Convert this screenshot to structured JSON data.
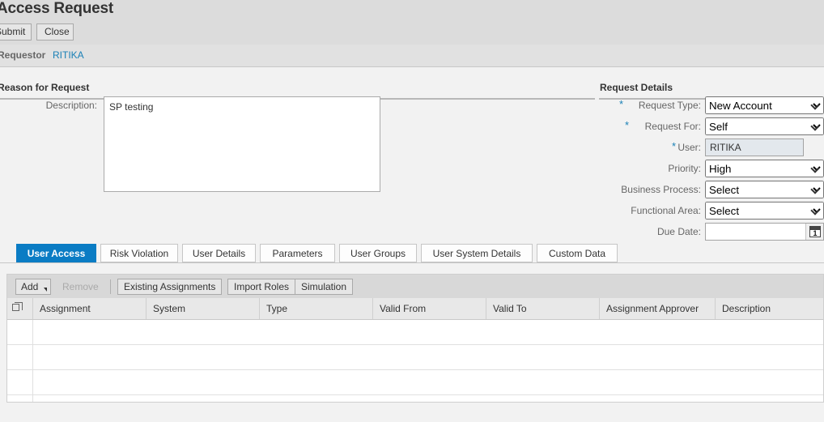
{
  "header": {
    "title": "Access Request",
    "submit_label": "Submit",
    "close_label": "Close",
    "requestor_label": "Requestor",
    "requestor_value": "RITIKA"
  },
  "reason_section": {
    "title": "Reason for Request",
    "description_label": "Description:",
    "description_value": "SP testing"
  },
  "request_details": {
    "title": "Request Details",
    "fields": [
      {
        "label": "Request Type:",
        "value": "New Account",
        "required": true,
        "type": "select"
      },
      {
        "label": "Request For:",
        "value": "Self",
        "required": true,
        "type": "select"
      },
      {
        "label": "User:",
        "value": "RITIKA",
        "required": true,
        "type": "readonly"
      },
      {
        "label": "Priority:",
        "value": "High",
        "required": false,
        "type": "select"
      },
      {
        "label": "Business Process:",
        "value": "Select",
        "required": false,
        "type": "select"
      },
      {
        "label": "Functional Area:",
        "value": "Select",
        "required": false,
        "type": "select"
      },
      {
        "label": "Due Date:",
        "value": "",
        "required": false,
        "type": "date"
      }
    ],
    "date_placeholder": "",
    "calendar_icon": "calendar-icon"
  },
  "tabs": [
    {
      "label": "User Access",
      "active": true
    },
    {
      "label": "Risk Violation",
      "active": false
    },
    {
      "label": "User Details",
      "active": false
    },
    {
      "label": "Parameters",
      "active": false
    },
    {
      "label": "User Groups",
      "active": false
    },
    {
      "label": "User System Details",
      "active": false
    },
    {
      "label": "Custom Data",
      "active": false
    }
  ],
  "table_toolbar": {
    "add_label": "Add",
    "remove_label": "Remove",
    "existing_assignments_label": "Existing Assignments",
    "import_roles_label": "Import Roles",
    "simulation_label": "Simulation"
  },
  "table": {
    "select_icon": "copy-columns-icon",
    "columns": [
      "Assignment",
      "System",
      "Type",
      "Valid From",
      "Valid To",
      "Assignment Approver",
      "Description"
    ],
    "rows": [],
    "empty_row_count": 4
  },
  "colors": {
    "accent": "#0a7cc4",
    "link": "#1a80b6",
    "required_star": "#1a80b6",
    "titlebar_bg": "#dcdcdc",
    "content_bg": "#f2f2f2",
    "toolbar_bg": "#d8d8d8",
    "table_header_bg": "#e8e8e8"
  }
}
